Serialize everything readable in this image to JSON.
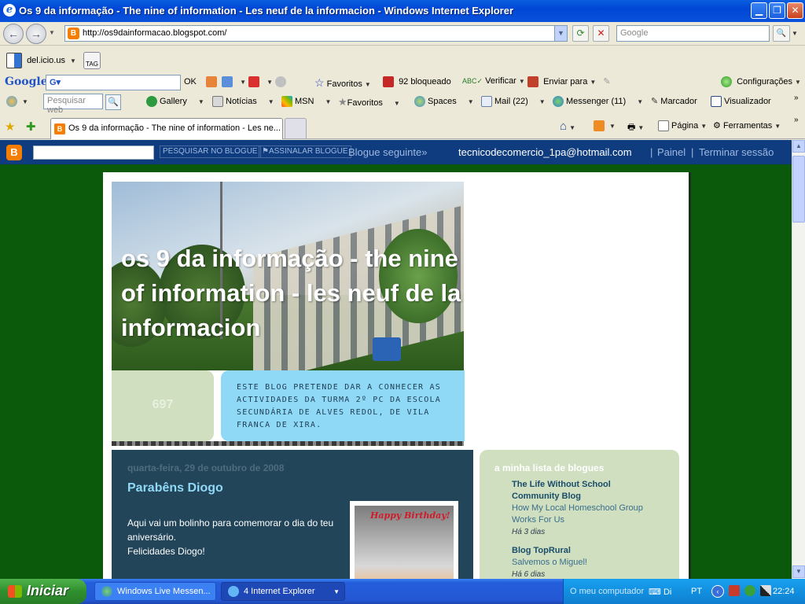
{
  "window": {
    "title": "Os 9 da informação - The nine of information - Les neuf de la informacion - Windows Internet Explorer",
    "min_glyph": "▁",
    "max_glyph": "❐",
    "close_glyph": "✕"
  },
  "address_bar": {
    "back_glyph": "←",
    "forward_glyph": "→",
    "url": "http://os9dainformacao.blogspot.com/",
    "refresh_glyph": "⟳",
    "stop_glyph": "✕",
    "search_placeholder": "Google",
    "search_glyph": "🔍"
  },
  "toolbar_delicious": {
    "label": "del.icio.us",
    "tag": "TAG"
  },
  "toolbar_google": {
    "logo": "Google",
    "ok": "OK",
    "favoritos": "Favoritos",
    "bloqueado": "92 bloqueado",
    "verificar": "Verificar",
    "enviar": "Enviar para",
    "configuracoes": "Configurações"
  },
  "toolbar_msn": {
    "search_placeholder": "Pesquisar web",
    "gallery": "Gallery",
    "noticias": "Notícias",
    "msn": "MSN",
    "favoritos": "Favoritos",
    "spaces": "Spaces",
    "mail": "Mail (22)",
    "messenger": "Messenger (11)",
    "marcador": "Marcador",
    "visualizador": "Visualizador"
  },
  "tabs": {
    "active_tab": "Os 9 da informação - The nine of information - Les ne...",
    "pagina": "Página",
    "ferramentas": "Ferramentas"
  },
  "blogger_navbar": {
    "search_button": "PESQUISAR NO BLOGUE",
    "flag_button": "ASSINALAR BLOGUE",
    "next_blog": "Blogue seguinte»",
    "user_email": "tecnicodecomercio_1pa@hotmail.com",
    "sep": "|",
    "painel": "Painel",
    "logout": "Terminar sessão"
  },
  "blog": {
    "title": "os 9 da informação - the nine of information - les neuf de la informacion",
    "counter": "697",
    "description": "ESTE BLOG PRETENDE DAR A CONHECER AS ACTIVIDADES DA TURMA 2º PC DA ESCOLA SECUNDÁRIA DE ALVES REDOL, DE VILA FRANCA DE XIRA."
  },
  "post": {
    "date": "quarta-feira, 29 de outubro de 2008",
    "title": "Parabêns Diogo",
    "body_line1": "Aqui vai um bolinho para comemorar o dia do teu aniversário.",
    "body_line2": "Felicidades Diogo!",
    "image_caption": "Happy Birthday!"
  },
  "sidebar": {
    "heading": "a minha lista de blogues",
    "blogs": [
      {
        "name": "The Life Without School Community Blog",
        "post": "How My Local Homeschool Group Works For Us",
        "ago": "Há 3 dias"
      },
      {
        "name": "Blog TopRural",
        "post": "Salvemos o Miguel!",
        "ago": "Há 6 dias"
      }
    ]
  },
  "taskbar": {
    "start": "Iniciar",
    "task1": "Windows Live Messen...",
    "task2": "4 Internet Explorer",
    "tray_computer": "O meu computador",
    "tray_di": "Di",
    "tray_lang": "PT",
    "clock": "22:24"
  },
  "colors": {
    "page_background": "#0B5A0B",
    "navbar": "#0E3C7E",
    "post_background": "#23455a",
    "sidebar_background": "#cfdfc0",
    "description_box": "#8fd9f6"
  }
}
